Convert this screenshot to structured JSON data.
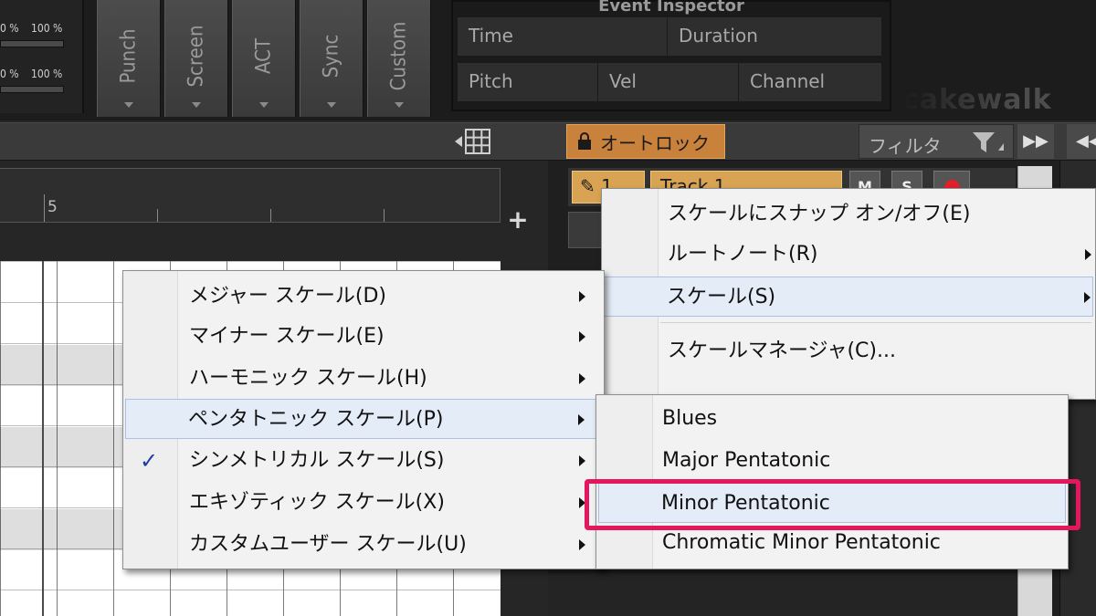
{
  "top": {
    "percent_labels": [
      "0 %",
      "100 %",
      "0 %",
      "100 %"
    ],
    "tabs": [
      "Punch",
      "Screen",
      "ACT",
      "Sync",
      "Custom"
    ],
    "event_inspector": {
      "title": "Event Inspector",
      "time_label": "Time",
      "duration_label": "Duration",
      "pitch_label": "Pitch",
      "vel_label": "Vel",
      "channel_label": "Channel"
    },
    "brand": "cakewalk"
  },
  "toolbar": {
    "autolock_label": "オートロック",
    "filter_label": "フィルタ"
  },
  "ruler": {
    "measure": "5"
  },
  "track": {
    "number": "1",
    "name": "Track 1",
    "mute": "M",
    "solo": "S"
  },
  "scale_menu": {
    "items": [
      {
        "label": "スケールにスナップ オン/オフ(E)",
        "submenu": false
      },
      {
        "label": "ルートノート(R)",
        "submenu": true
      },
      {
        "label": "スケール(S)",
        "submenu": true,
        "highlighted": true
      },
      {
        "label": "スケールマネージャ(C)...",
        "submenu": false
      }
    ]
  },
  "scale_type_menu": {
    "items": [
      {
        "label": "メジャー スケール(D)",
        "checked": false
      },
      {
        "label": "マイナー スケール(E)",
        "checked": false
      },
      {
        "label": "ハーモニック スケール(H)",
        "checked": false
      },
      {
        "label": "ペンタトニック スケール(P)",
        "checked": false,
        "highlighted": true
      },
      {
        "label": "シンメトリカル スケール(S)",
        "checked": true
      },
      {
        "label": "エキゾティック スケール(X)",
        "checked": false
      },
      {
        "label": "カスタムユーザー スケール(U)",
        "checked": false
      }
    ],
    "check_glyph": "✓"
  },
  "pentatonic_menu": {
    "items": [
      {
        "label": "Blues"
      },
      {
        "label": "Major Pentatonic"
      },
      {
        "label": "Minor Pentatonic",
        "highlighted": true
      },
      {
        "label": "Chromatic Minor Pentatonic"
      }
    ]
  },
  "colors": {
    "autolock": "#c9823b",
    "highlight_callout": "#e5165d",
    "menu_highlight": "#e4ecf7",
    "check": "#1b3fa0"
  }
}
